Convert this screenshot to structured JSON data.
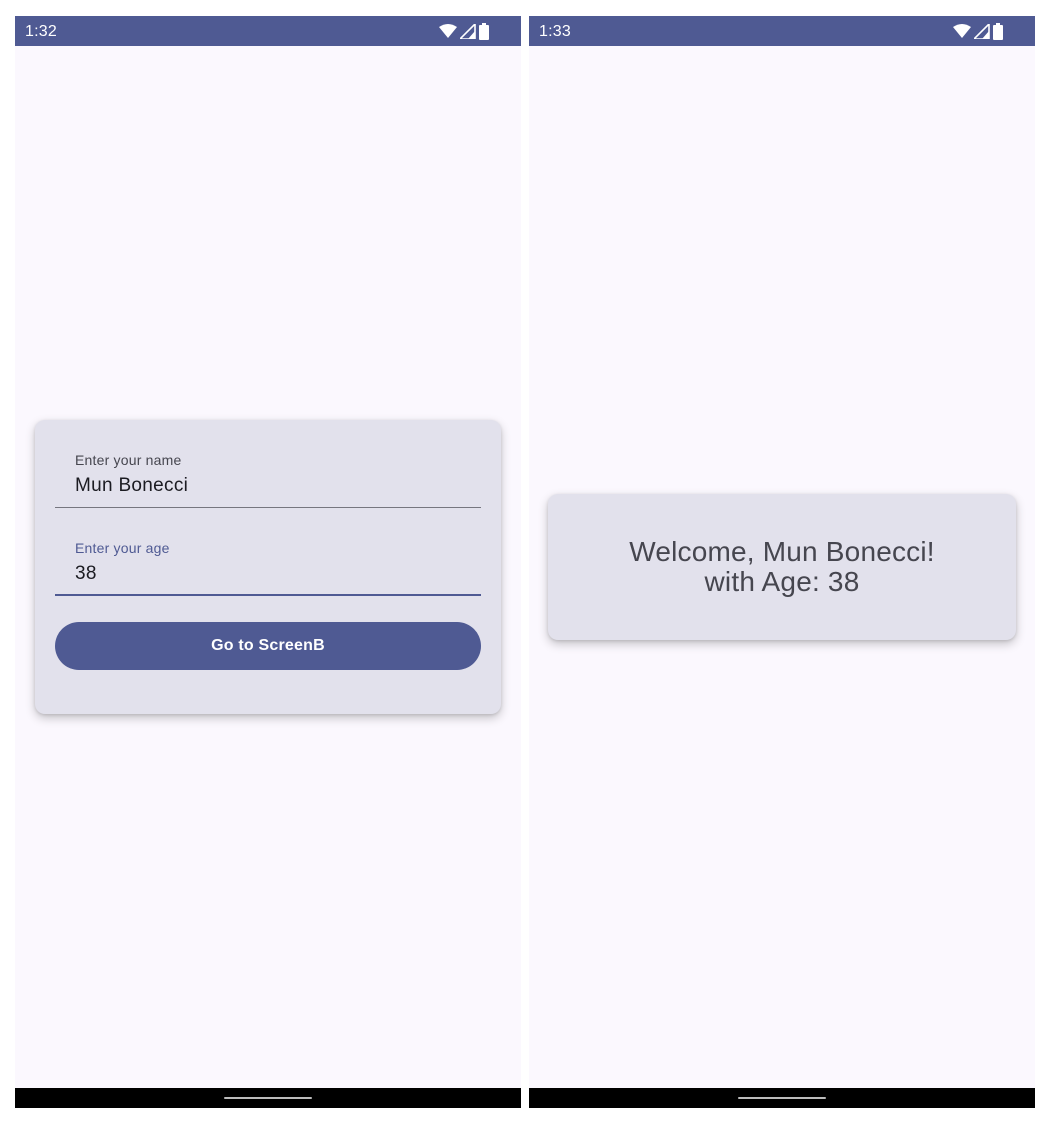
{
  "colors": {
    "status_bar": "#4f5a93",
    "screen_background": "#fbf8fe",
    "card_background": "#e2e1ec",
    "primary": "#4f5a93",
    "nav_bar": "#000000"
  },
  "screen_a": {
    "status_bar": {
      "time": "1:32",
      "icons": [
        "wifi-icon",
        "cellular-signal-icon",
        "battery-icon"
      ]
    },
    "form": {
      "name_field": {
        "label": "Enter your name",
        "value": "Mun Bonecci"
      },
      "age_field": {
        "label": "Enter your age",
        "value": "38"
      },
      "submit_button": {
        "label": "Go to ScreenB"
      }
    }
  },
  "screen_b": {
    "status_bar": {
      "time": "1:33",
      "icons": [
        "wifi-icon",
        "cellular-signal-icon",
        "battery-icon"
      ]
    },
    "welcome": {
      "line1": "Welcome, Mun Bonecci!",
      "line2": "with Age: 38"
    }
  }
}
